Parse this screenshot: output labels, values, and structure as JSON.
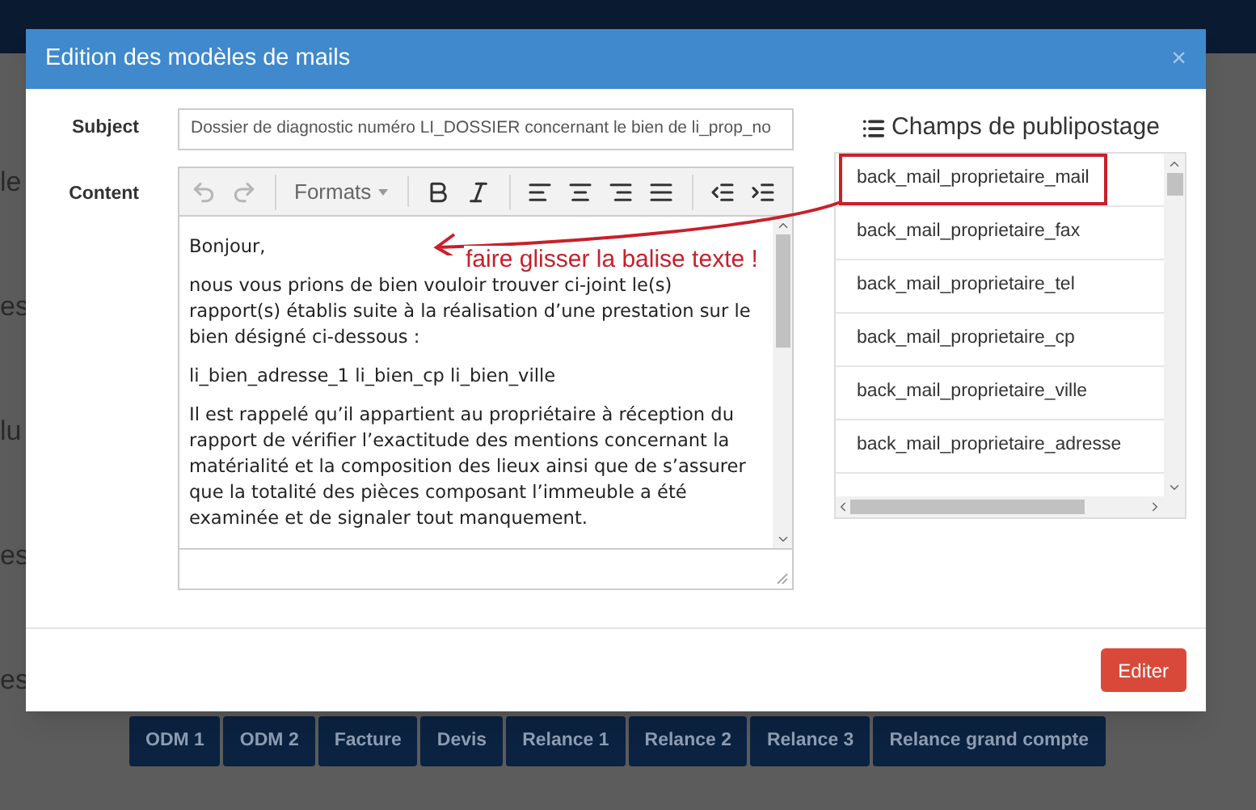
{
  "background_labels": [
    "le",
    "es",
    "lu",
    "es",
    "es"
  ],
  "modal": {
    "title": "Edition des modèles de mails",
    "close": "×",
    "subject": {
      "label": "Subject",
      "value": "Dossier de diagnostic numéro LI_DOSSIER concernant le bien de li_prop_no"
    },
    "content": {
      "label": "Content",
      "toolbar": [
        {
          "kind": "undo",
          "disabled": true
        },
        {
          "kind": "redo",
          "disabled": true
        },
        {
          "kind": "formats",
          "label": "Formats",
          "disabled": false
        },
        {
          "kind": "bold",
          "disabled": false
        },
        {
          "kind": "italic",
          "disabled": false
        },
        {
          "kind": "align-left",
          "disabled": false
        },
        {
          "kind": "align-center",
          "disabled": false
        },
        {
          "kind": "align-right",
          "disabled": false
        },
        {
          "kind": "justify",
          "disabled": false
        },
        {
          "kind": "outdent",
          "disabled": false
        },
        {
          "kind": "indent",
          "disabled": false
        }
      ],
      "paragraphs": [
        "Bonjour,",
        "nous vous prions de bien vouloir trouver ci-joint le(s) rapport(s) établis suite à la réalisation d’une prestation sur le bien désigné ci-dessous :",
        "li_bien_adresse_1 li_bien_cp li_bien_ville",
        "Il est rappelé qu’il appartient au propriétaire à réception du rapport de vérifier l’exactitude des mentions concernant la matérialité et la composition des lieux ainsi que de s’assurer que la totalité des pièces composant l’immeuble a été examinée et de signaler tout manquement."
      ]
    },
    "fields": {
      "title": "Champs de publipostage",
      "items": [
        {
          "label": "back_mail_proprietaire_mail",
          "selected": true
        },
        {
          "label": "back_mail_proprietaire_fax",
          "selected": false
        },
        {
          "label": "back_mail_proprietaire_tel",
          "selected": false
        },
        {
          "label": "back_mail_proprietaire_cp",
          "selected": false
        },
        {
          "label": "back_mail_proprietaire_ville",
          "selected": false
        },
        {
          "label": "back_mail_proprietaire_adresse",
          "selected": false
        }
      ]
    },
    "annotation": "faire glisser la balise texte !",
    "submit": "Editer"
  },
  "template_buttons": [
    "ODM 1",
    "ODM 2",
    "Facture",
    "Devis",
    "Relance 1",
    "Relance 2",
    "Relance 3",
    "Relance grand compte"
  ]
}
